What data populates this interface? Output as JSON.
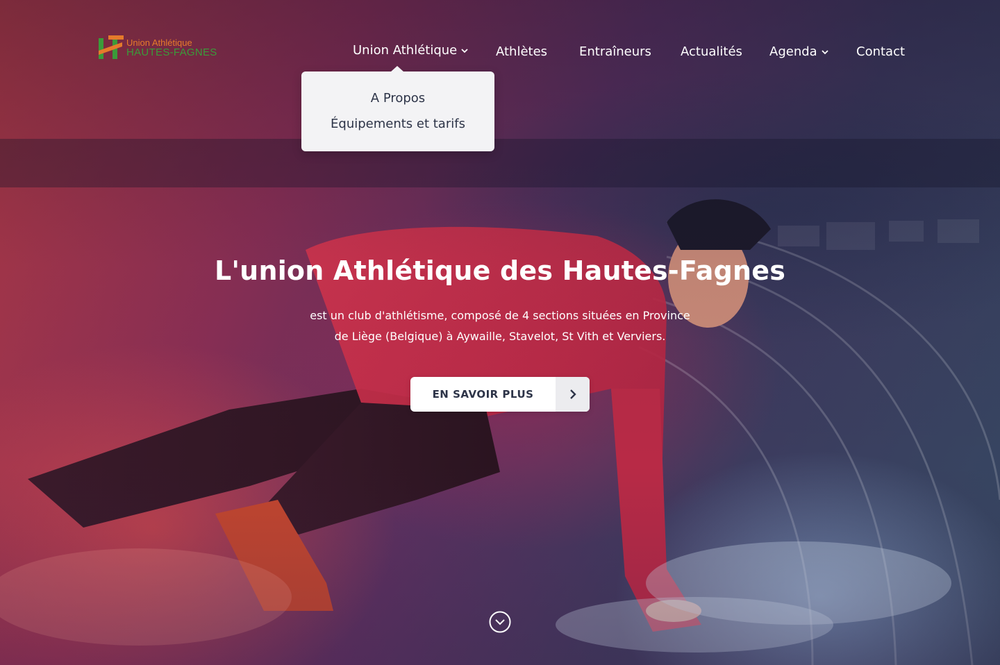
{
  "logo": {
    "line1": "Union Athlétique",
    "line2": "HAUTES-FAGNES",
    "colors": {
      "orange": "#e57a2b",
      "green": "#3b9b3a"
    }
  },
  "nav": {
    "items": [
      {
        "label": "Union Athlétique",
        "has_dropdown": true,
        "open": true
      },
      {
        "label": "Athlètes",
        "has_dropdown": false
      },
      {
        "label": "Entraîneurs",
        "has_dropdown": false
      },
      {
        "label": "Actualités",
        "has_dropdown": false
      },
      {
        "label": "Agenda",
        "has_dropdown": true
      },
      {
        "label": "Contact",
        "has_dropdown": false
      }
    ],
    "dropdown": {
      "items": [
        {
          "label": "A Propos"
        },
        {
          "label": "Équipements et tarifs"
        }
      ]
    }
  },
  "hero": {
    "title": "L'union Athlétique des Hautes-Fagnes",
    "subtitle_line1": "est un club d'athlétisme, composé de 4 sections situées en Province",
    "subtitle_line2": "de Liège (Belgique) à Aywaille, Stavelot, St Vith et Verviers.",
    "cta_label": "EN SAVOIR PLUS",
    "icons": {
      "cta": "chevron-right-icon",
      "scroll": "chevron-down-circle-icon"
    }
  },
  "colors": {
    "overlay_red": "#b43a45",
    "overlay_purple": "#5a3160",
    "overlay_blue": "#354862",
    "dark_text": "#2d3448",
    "dropdown_bg": "#f3f3f5"
  }
}
